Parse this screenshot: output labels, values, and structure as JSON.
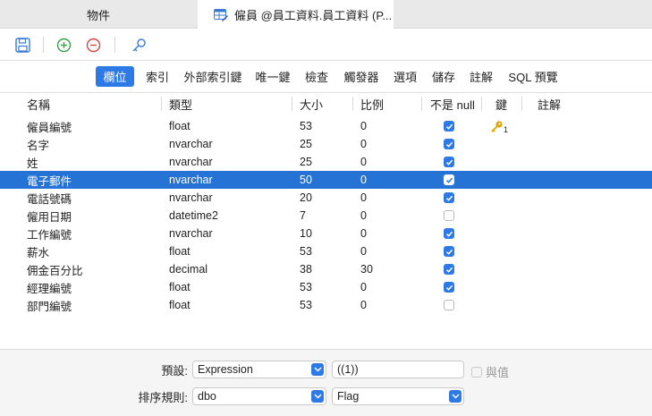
{
  "tabs": {
    "objects_label": "物件",
    "table_label": "僱員 @員工資料.員工資料 (P..."
  },
  "subtabs": [
    {
      "label": "欄位",
      "active": true
    },
    {
      "label": "索引"
    },
    {
      "label": "外部索引鍵"
    },
    {
      "label": "唯一鍵"
    },
    {
      "label": "檢查"
    },
    {
      "label": "觸發器"
    },
    {
      "label": "選項"
    },
    {
      "label": "儲存"
    },
    {
      "label": "註解"
    },
    {
      "label": "SQL 預覽"
    }
  ],
  "columns_header": {
    "name": "名稱",
    "type": "類型",
    "size": "大小",
    "scale": "比例",
    "not_null": "不是 null",
    "key": "鍵",
    "comment": "註解"
  },
  "rows": [
    {
      "name": "僱員編號",
      "type": "float",
      "size": "53",
      "scale": "0",
      "not_null": true,
      "key": "1"
    },
    {
      "name": "名字",
      "type": "nvarchar",
      "size": "25",
      "scale": "0",
      "not_null": true
    },
    {
      "name": "姓",
      "type": "nvarchar",
      "size": "25",
      "scale": "0",
      "not_null": true
    },
    {
      "name": "電子郵件",
      "type": "nvarchar",
      "size": "50",
      "scale": "0",
      "not_null": true,
      "selected": true
    },
    {
      "name": "電話號碼",
      "type": "nvarchar",
      "size": "20",
      "scale": "0",
      "not_null": true
    },
    {
      "name": "僱用日期",
      "type": "datetime2",
      "size": "7",
      "scale": "0",
      "not_null": false
    },
    {
      "name": "工作編號",
      "type": "nvarchar",
      "size": "10",
      "scale": "0",
      "not_null": true
    },
    {
      "name": "薪水",
      "type": "float",
      "size": "53",
      "scale": "0",
      "not_null": true
    },
    {
      "name": "佣金百分比",
      "type": "decimal",
      "size": "38",
      "scale": "30",
      "not_null": true
    },
    {
      "name": "經理編號",
      "type": "float",
      "size": "53",
      "scale": "0",
      "not_null": true
    },
    {
      "name": "部門編號",
      "type": "float",
      "size": "53",
      "scale": "0",
      "not_null": false
    }
  ],
  "bottom": {
    "default_label": "預設:",
    "default_type": "Expression",
    "default_value": "((1))",
    "with_value_label": "與值",
    "collation_label": "排序規則:",
    "collation_value": "dbo",
    "collation_second": "Flag"
  },
  "colors": {
    "accent": "#2d7ae6",
    "selected_row": "#2673d6",
    "add_icon": "#3aa04a",
    "remove_icon": "#d64545",
    "save_icon": "#3a7bd5",
    "key_icon": "#e0a400"
  }
}
